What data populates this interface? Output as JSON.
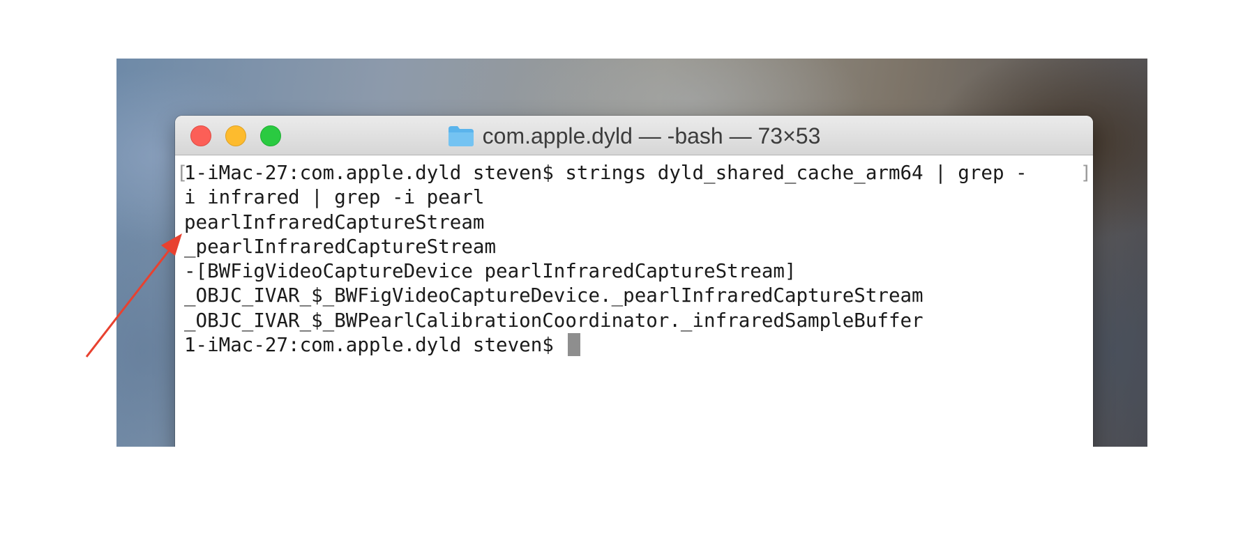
{
  "window": {
    "title": "com.apple.dyld — -bash — 73×53"
  },
  "terminal": {
    "lines": [
      "1-iMac-27:com.apple.dyld steven$ strings dyld_shared_cache_arm64 | grep -",
      "i infrared | grep -i pearl",
      "pearlInfraredCaptureStream",
      "_pearlInfraredCaptureStream",
      "-[BWFigVideoCaptureDevice pearlInfraredCaptureStream]",
      "_OBJC_IVAR_$_BWFigVideoCaptureDevice._pearlInfraredCaptureStream",
      "_OBJC_IVAR_$_BWPearlCalibrationCoordinator._infraredSampleBuffer",
      "1-iMac-27:com.apple.dyld steven$ "
    ],
    "left_bracket": "[",
    "right_bracket": "]"
  },
  "annotation": {
    "arrow_color": "#e8412f"
  },
  "colors": {
    "close": "#fc5f57",
    "minimize": "#fdbb2e",
    "zoom": "#2aca41",
    "folder": "#5ab4ec"
  }
}
